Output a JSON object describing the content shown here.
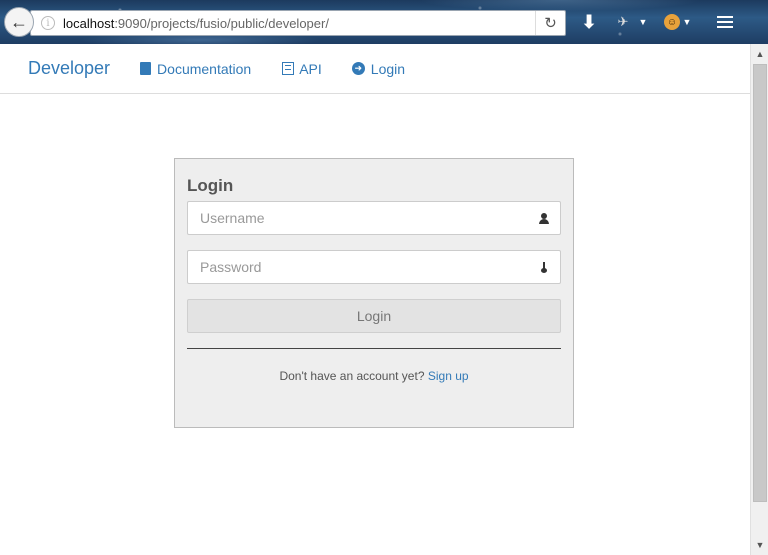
{
  "browser": {
    "url_host": "localhost",
    "url_rest": ":9090/projects/fusio/public/developer/",
    "back_glyph": "←",
    "info_glyph": "i",
    "reload_glyph": "↻",
    "download_glyph": "⬇",
    "satellite_glyph": "✈",
    "dropdown_glyph": "▼",
    "monkey_glyph": "☺"
  },
  "navbar": {
    "brand": "Developer",
    "items": [
      {
        "label": "Documentation",
        "icon": "book-icon"
      },
      {
        "label": "API",
        "icon": "list-icon"
      },
      {
        "label": "Login",
        "icon": "circle-arrow-right-icon"
      }
    ],
    "login_icon_glyph": "➜"
  },
  "login": {
    "title": "Login",
    "username_placeholder": "Username",
    "password_placeholder": "Password",
    "button_label": "Login",
    "signup_prompt": "Don't have an account yet?",
    "signup_link": "Sign up"
  },
  "scrollbar": {
    "up_glyph": "▲",
    "down_glyph": "▼"
  },
  "colors": {
    "link": "#337ab7",
    "panel_bg": "#eeeeee",
    "button_bg": "#e3e3e3"
  }
}
